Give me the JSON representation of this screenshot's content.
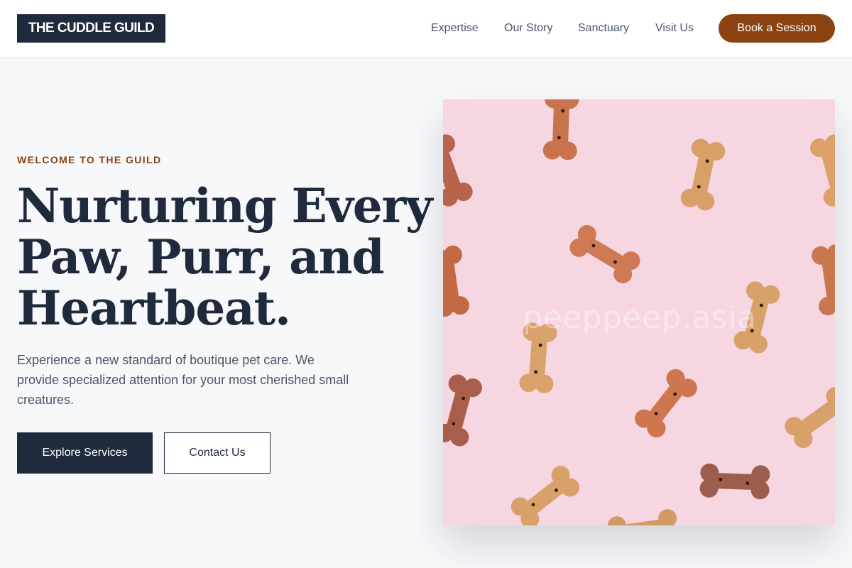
{
  "header": {
    "logo": "THE CUDDLE GUILD",
    "nav": [
      "Expertise",
      "Our Story",
      "Sanctuary",
      "Visit Us"
    ],
    "cta": "Book a Session"
  },
  "hero": {
    "eyebrow": "WELCOME TO THE GUILD",
    "headline": [
      "Nurturing Every",
      "Paw, Purr, and",
      "Heartbeat."
    ],
    "lead": "Experience a new standard of boutique pet care. We provide specialized attention for your most cherished small creatures.",
    "primary_button": "Explore Services",
    "secondary_button": "Contact Us"
  },
  "image": {
    "watermark": "peeppeep.asia",
    "subject": "dog-bone-biscuits"
  },
  "colors": {
    "navy": "#1f2a3d",
    "accent": "#8a4210",
    "text_muted": "#4a5568",
    "page_bg": "#f7f8fa",
    "photo_bg": "#f6d6e0"
  }
}
